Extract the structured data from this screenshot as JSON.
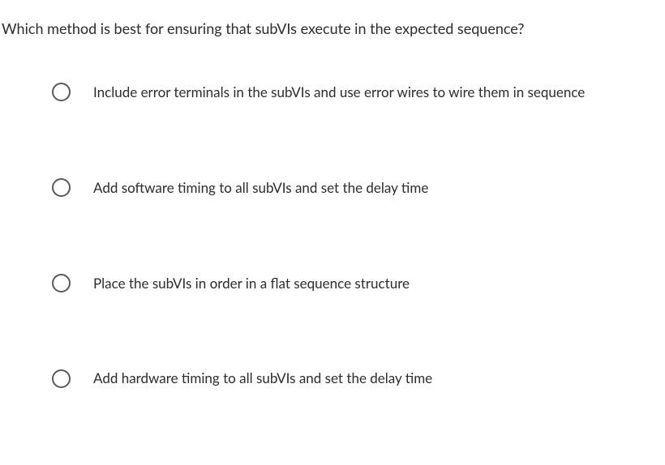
{
  "question": {
    "text": "Which method is best for ensuring that subVIs execute in the expected sequence?"
  },
  "options": [
    {
      "label": "Include error terminals in the subVIs and use error wires to wire them in sequence"
    },
    {
      "label": "Add software timing to all subVIs and set the delay time"
    },
    {
      "label": "Place the subVIs in order in a flat sequence structure"
    },
    {
      "label": "Add hardware timing to all subVIs and set the delay time"
    }
  ]
}
